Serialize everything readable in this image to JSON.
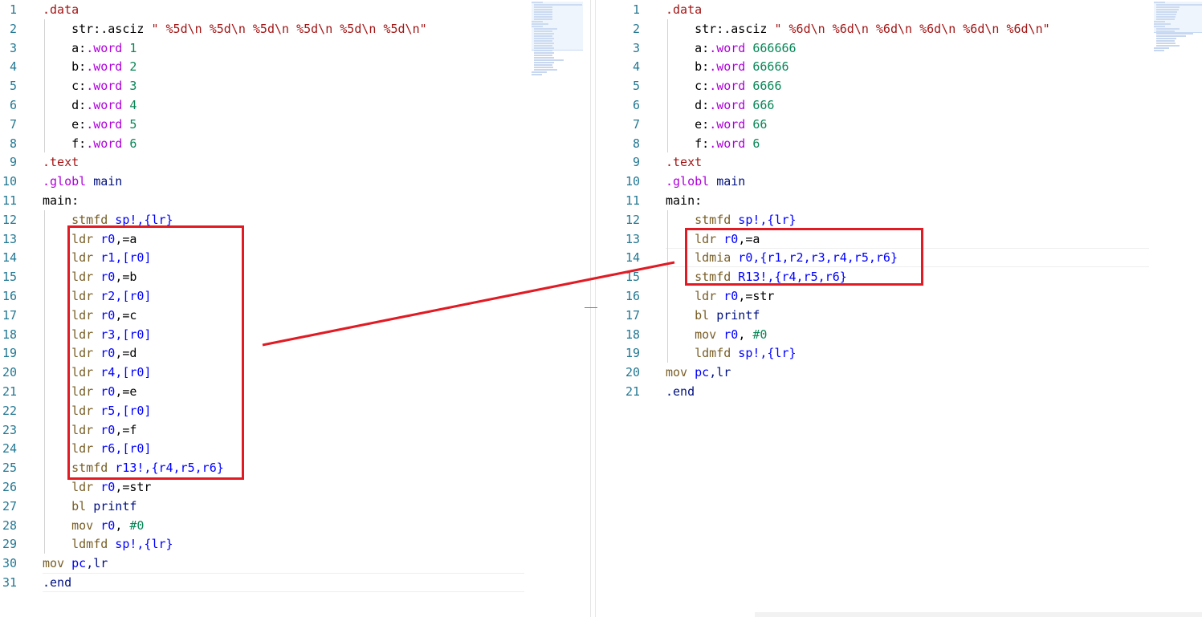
{
  "left_editor": {
    "lines": [
      {
        "n": "1",
        "indent": 0,
        "tokens": [
          {
            "t": ".data",
            "c": "directive"
          }
        ]
      },
      {
        "n": "2",
        "indent": 1,
        "tokens": [
          {
            "t": "str:",
            "c": "label"
          },
          {
            "t": ".asciz",
            "c": "label"
          },
          {
            "t": " \" %5d\\n %5d\\n %5d\\n %5d\\n %5d\\n %5d\\n\"",
            "c": "str"
          }
        ]
      },
      {
        "n": "3",
        "indent": 1,
        "tokens": [
          {
            "t": "a:",
            "c": "label"
          },
          {
            "t": ".word",
            "c": "purple"
          },
          {
            "t": " 1",
            "c": "num"
          }
        ]
      },
      {
        "n": "4",
        "indent": 1,
        "tokens": [
          {
            "t": "b:",
            "c": "label"
          },
          {
            "t": ".word",
            "c": "purple"
          },
          {
            "t": " 2",
            "c": "num"
          }
        ]
      },
      {
        "n": "5",
        "indent": 1,
        "tokens": [
          {
            "t": "c:",
            "c": "label"
          },
          {
            "t": ".word",
            "c": "purple"
          },
          {
            "t": " 3",
            "c": "num"
          }
        ]
      },
      {
        "n": "6",
        "indent": 1,
        "tokens": [
          {
            "t": "d:",
            "c": "label"
          },
          {
            "t": ".word",
            "c": "purple"
          },
          {
            "t": " 4",
            "c": "num"
          }
        ]
      },
      {
        "n": "7",
        "indent": 1,
        "tokens": [
          {
            "t": "e:",
            "c": "label"
          },
          {
            "t": ".word",
            "c": "purple"
          },
          {
            "t": " 5",
            "c": "num"
          }
        ]
      },
      {
        "n": "8",
        "indent": 1,
        "tokens": [
          {
            "t": "f:",
            "c": "label"
          },
          {
            "t": ".word",
            "c": "purple"
          },
          {
            "t": " 6",
            "c": "num"
          }
        ]
      },
      {
        "n": "9",
        "indent": 0,
        "tokens": [
          {
            "t": ".text",
            "c": "directive"
          }
        ]
      },
      {
        "n": "10",
        "indent": 0,
        "tokens": [
          {
            "t": ".globl",
            "c": "purple"
          },
          {
            "t": " main",
            "c": "sym"
          }
        ]
      },
      {
        "n": "11",
        "indent": 0,
        "tokens": [
          {
            "t": "main:",
            "c": "label"
          }
        ]
      },
      {
        "n": "12",
        "indent": 1,
        "tokens": [
          {
            "t": "stmfd",
            "c": "mnemonic"
          },
          {
            "t": " sp!,{lr}",
            "c": "reg"
          }
        ]
      },
      {
        "n": "13",
        "indent": 1,
        "tokens": [
          {
            "t": "ldr",
            "c": "mnemonic"
          },
          {
            "t": " r0",
            "c": "reg"
          },
          {
            "t": ",=a",
            "c": "label"
          }
        ]
      },
      {
        "n": "14",
        "indent": 1,
        "tokens": [
          {
            "t": "ldr",
            "c": "mnemonic"
          },
          {
            "t": " r1",
            "c": "reg"
          },
          {
            "t": ",[r0]",
            "c": "reg"
          }
        ]
      },
      {
        "n": "15",
        "indent": 1,
        "tokens": [
          {
            "t": "ldr",
            "c": "mnemonic"
          },
          {
            "t": " r0",
            "c": "reg"
          },
          {
            "t": ",=b",
            "c": "label"
          }
        ]
      },
      {
        "n": "16",
        "indent": 1,
        "tokens": [
          {
            "t": "ldr",
            "c": "mnemonic"
          },
          {
            "t": " r2",
            "c": "reg"
          },
          {
            "t": ",[r0]",
            "c": "reg"
          }
        ]
      },
      {
        "n": "17",
        "indent": 1,
        "tokens": [
          {
            "t": "ldr",
            "c": "mnemonic"
          },
          {
            "t": " r0",
            "c": "reg"
          },
          {
            "t": ",=c",
            "c": "label"
          }
        ]
      },
      {
        "n": "18",
        "indent": 1,
        "tokens": [
          {
            "t": "ldr",
            "c": "mnemonic"
          },
          {
            "t": " r3",
            "c": "reg"
          },
          {
            "t": ",[r0]",
            "c": "reg"
          }
        ]
      },
      {
        "n": "19",
        "indent": 1,
        "tokens": [
          {
            "t": "ldr",
            "c": "mnemonic"
          },
          {
            "t": " r0",
            "c": "reg"
          },
          {
            "t": ",=d",
            "c": "label"
          }
        ]
      },
      {
        "n": "20",
        "indent": 1,
        "tokens": [
          {
            "t": "ldr",
            "c": "mnemonic"
          },
          {
            "t": " r4",
            "c": "reg"
          },
          {
            "t": ",[r0]",
            "c": "reg"
          }
        ]
      },
      {
        "n": "21",
        "indent": 1,
        "tokens": [
          {
            "t": "ldr",
            "c": "mnemonic"
          },
          {
            "t": " r0",
            "c": "reg"
          },
          {
            "t": ",=e",
            "c": "label"
          }
        ]
      },
      {
        "n": "22",
        "indent": 1,
        "tokens": [
          {
            "t": "ldr",
            "c": "mnemonic"
          },
          {
            "t": " r5",
            "c": "reg"
          },
          {
            "t": ",[r0]",
            "c": "reg"
          }
        ]
      },
      {
        "n": "23",
        "indent": 1,
        "tokens": [
          {
            "t": "ldr",
            "c": "mnemonic"
          },
          {
            "t": " r0",
            "c": "reg"
          },
          {
            "t": ",=f",
            "c": "label"
          }
        ]
      },
      {
        "n": "24",
        "indent": 1,
        "tokens": [
          {
            "t": "ldr",
            "c": "mnemonic"
          },
          {
            "t": " r6",
            "c": "reg"
          },
          {
            "t": ",[r0]",
            "c": "reg"
          }
        ]
      },
      {
        "n": "25",
        "indent": 1,
        "tokens": [
          {
            "t": "stmfd",
            "c": "mnemonic"
          },
          {
            "t": " r13!,{r4,r5,r6}",
            "c": "reg"
          }
        ]
      },
      {
        "n": "26",
        "indent": 1,
        "tokens": [
          {
            "t": "ldr",
            "c": "mnemonic"
          },
          {
            "t": " r0",
            "c": "reg"
          },
          {
            "t": ",=str",
            "c": "label"
          }
        ]
      },
      {
        "n": "27",
        "indent": 1,
        "tokens": [
          {
            "t": "bl",
            "c": "mnemonic"
          },
          {
            "t": " printf",
            "c": "sym"
          }
        ]
      },
      {
        "n": "28",
        "indent": 1,
        "tokens": [
          {
            "t": "mov",
            "c": "mnemonic"
          },
          {
            "t": " r0",
            "c": "reg"
          },
          {
            "t": ", ",
            "c": "label"
          },
          {
            "t": "#0",
            "c": "num"
          }
        ]
      },
      {
        "n": "29",
        "indent": 1,
        "tokens": [
          {
            "t": "ldmfd",
            "c": "mnemonic"
          },
          {
            "t": " sp!,{lr}",
            "c": "reg"
          }
        ]
      },
      {
        "n": "30",
        "indent": 0,
        "tokens": [
          {
            "t": "mov",
            "c": "mnemonic"
          },
          {
            "t": " pc",
            "c": "reg"
          },
          {
            "t": ",lr",
            "c": "sym"
          }
        ]
      },
      {
        "n": "31",
        "indent": 0,
        "tokens": [
          {
            "t": ".end",
            "c": "sym"
          }
        ]
      }
    ]
  },
  "right_editor": {
    "lines": [
      {
        "n": "1",
        "indent": 0,
        "tokens": [
          {
            "t": ".data",
            "c": "directive"
          }
        ]
      },
      {
        "n": "2",
        "indent": 1,
        "tokens": [
          {
            "t": "str:",
            "c": "label"
          },
          {
            "t": ".asciz",
            "c": "label"
          },
          {
            "t": " \" %6d\\n %6d\\n %6d\\n %6d\\n %6d\\n %6d\\n\"",
            "c": "str"
          }
        ]
      },
      {
        "n": "3",
        "indent": 1,
        "tokens": [
          {
            "t": "a:",
            "c": "label"
          },
          {
            "t": ".word",
            "c": "purple"
          },
          {
            "t": " 666666",
            "c": "num"
          }
        ]
      },
      {
        "n": "4",
        "indent": 1,
        "tokens": [
          {
            "t": "b:",
            "c": "label"
          },
          {
            "t": ".word",
            "c": "purple"
          },
          {
            "t": " 66666",
            "c": "num"
          }
        ]
      },
      {
        "n": "5",
        "indent": 1,
        "tokens": [
          {
            "t": "c:",
            "c": "label"
          },
          {
            "t": ".word",
            "c": "purple"
          },
          {
            "t": " 6666",
            "c": "num"
          }
        ]
      },
      {
        "n": "6",
        "indent": 1,
        "tokens": [
          {
            "t": "d:",
            "c": "label"
          },
          {
            "t": ".word",
            "c": "purple"
          },
          {
            "t": " 666",
            "c": "num"
          }
        ]
      },
      {
        "n": "7",
        "indent": 1,
        "tokens": [
          {
            "t": "e:",
            "c": "label"
          },
          {
            "t": ".word",
            "c": "purple"
          },
          {
            "t": " 66",
            "c": "num"
          }
        ]
      },
      {
        "n": "8",
        "indent": 1,
        "tokens": [
          {
            "t": "f:",
            "c": "label"
          },
          {
            "t": ".word",
            "c": "purple"
          },
          {
            "t": " 6",
            "c": "num"
          }
        ]
      },
      {
        "n": "9",
        "indent": 0,
        "tokens": [
          {
            "t": ".text",
            "c": "directive"
          }
        ]
      },
      {
        "n": "10",
        "indent": 0,
        "tokens": [
          {
            "t": ".globl",
            "c": "purple"
          },
          {
            "t": " main",
            "c": "sym"
          }
        ]
      },
      {
        "n": "11",
        "indent": 0,
        "tokens": [
          {
            "t": "main:",
            "c": "label"
          }
        ]
      },
      {
        "n": "12",
        "indent": 1,
        "tokens": [
          {
            "t": "stmfd",
            "c": "mnemonic"
          },
          {
            "t": " sp!,{lr}",
            "c": "reg"
          }
        ]
      },
      {
        "n": "13",
        "indent": 1,
        "tokens": [
          {
            "t": "ldr",
            "c": "mnemonic"
          },
          {
            "t": " r0",
            "c": "reg"
          },
          {
            "t": ",=a",
            "c": "label"
          }
        ]
      },
      {
        "n": "14",
        "indent": 1,
        "tokens": [
          {
            "t": "ldmia",
            "c": "mnemonic"
          },
          {
            "t": " r0",
            "c": "reg"
          },
          {
            "t": ",{r1,r2,r3,r4,r5,r6}",
            "c": "reg"
          }
        ]
      },
      {
        "n": "15",
        "indent": 1,
        "tokens": [
          {
            "t": "stmfd",
            "c": "mnemonic"
          },
          {
            "t": " R13!,{r4,r5,r6}",
            "c": "reg"
          }
        ]
      },
      {
        "n": "16",
        "indent": 1,
        "tokens": [
          {
            "t": "ldr",
            "c": "mnemonic"
          },
          {
            "t": " r0",
            "c": "reg"
          },
          {
            "t": ",=str",
            "c": "label"
          }
        ]
      },
      {
        "n": "17",
        "indent": 1,
        "tokens": [
          {
            "t": "bl",
            "c": "mnemonic"
          },
          {
            "t": " printf",
            "c": "sym"
          }
        ]
      },
      {
        "n": "18",
        "indent": 1,
        "tokens": [
          {
            "t": "mov",
            "c": "mnemonic"
          },
          {
            "t": " r0",
            "c": "reg"
          },
          {
            "t": ", ",
            "c": "label"
          },
          {
            "t": "#0",
            "c": "num"
          }
        ]
      },
      {
        "n": "19",
        "indent": 1,
        "tokens": [
          {
            "t": "ldmfd",
            "c": "mnemonic"
          },
          {
            "t": " sp!,{lr}",
            "c": "reg"
          }
        ]
      },
      {
        "n": "20",
        "indent": 0,
        "tokens": [
          {
            "t": "mov",
            "c": "mnemonic"
          },
          {
            "t": " pc",
            "c": "reg"
          },
          {
            "t": ",lr",
            "c": "sym"
          }
        ]
      },
      {
        "n": "21",
        "indent": 0,
        "tokens": [
          {
            "t": ".end",
            "c": "sym"
          }
        ]
      }
    ]
  },
  "annotation": {
    "color": "#e01b24",
    "left_highlight_lines": [
      "13",
      "25"
    ],
    "right_highlight_lines": [
      "13",
      "15"
    ]
  }
}
